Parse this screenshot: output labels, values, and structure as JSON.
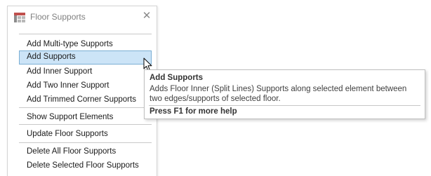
{
  "panel": {
    "title": "Floor Supports",
    "close_glyph": "✕",
    "icon": "floor-supports-icon",
    "items": [
      {
        "label": "Add Multi-type Supports"
      },
      {
        "label": "Add Supports",
        "hovered": true
      },
      {
        "label": "Add Inner Support"
      },
      {
        "label": "Add Two Inner Support"
      },
      {
        "label": "Add Trimmed Corner Supports"
      },
      {
        "label": "Show Support Elements"
      },
      {
        "label": "Update Floor Supports"
      },
      {
        "label": "Delete All Floor Supports"
      },
      {
        "label": "Delete Selected Floor Supports"
      }
    ]
  },
  "tooltip": {
    "title": "Add Supports",
    "description": "Adds Floor Inner (Split Lines) Supports along selected element between two edges/supports of selected floor.",
    "help": "Press F1 for more help"
  },
  "colors": {
    "hover_fill": "#cce4f7",
    "hover_border": "#7aaed4",
    "title_text": "#808080"
  }
}
